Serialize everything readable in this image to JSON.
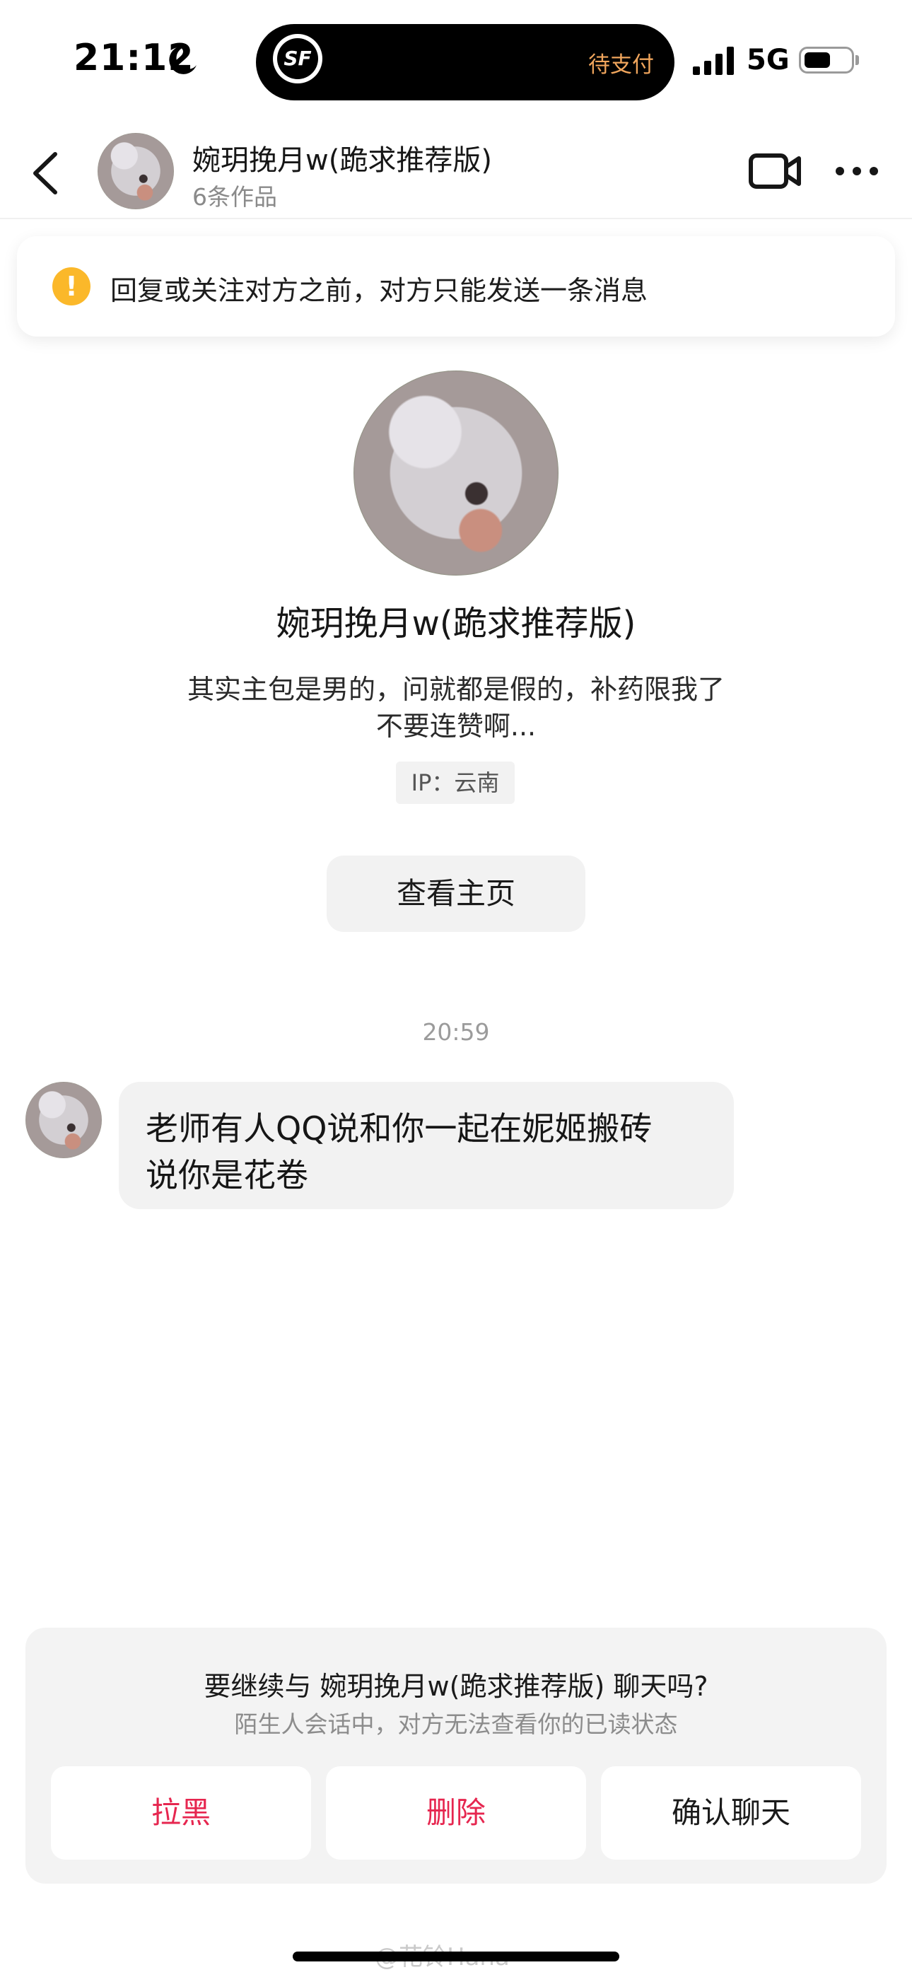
{
  "status_bar": {
    "time": "21:12",
    "island_pay_text": "待支付",
    "island_logo_text": "SF",
    "network": "5G"
  },
  "header": {
    "name": "婉玥挽月w(跪求推荐版)",
    "works": "6条作品"
  },
  "notice": {
    "icon": "!",
    "text": "回复或关注对方之前，对方只能发送一条消息"
  },
  "profile": {
    "name": "婉玥挽月w(跪求推荐版)",
    "bio_line1": "其实主包是男的，问就都是假的，补药限我了",
    "bio_line2": "不要连赞啊...",
    "ip": "IP：云南",
    "view_home_button": "查看主页"
  },
  "chat": {
    "time": "20:59",
    "message_line1": "老师有人QQ说和你一起在妮姬搬砖",
    "message_line2": "说你是花卷"
  },
  "panel": {
    "question": "要继续与 婉玥挽月w(跪求推荐版) 聊天吗?",
    "subtitle": "陌生人会话中，对方无法查看你的已读状态",
    "block_button": "拉黑",
    "delete_button": "删除",
    "confirm_button": "确认聊天"
  },
  "watermark": "@花铃Hana",
  "colors": {
    "danger": "#e6264f",
    "warning": "#fbb82a",
    "bubble": "#f2f2f2"
  }
}
